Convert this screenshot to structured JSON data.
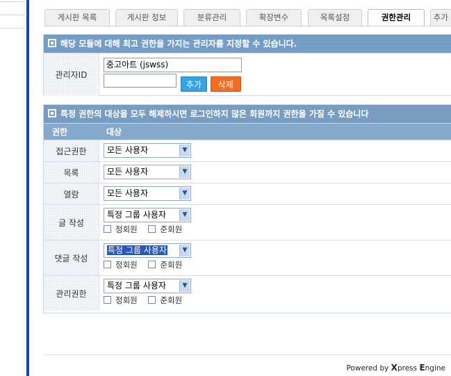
{
  "tabs": [
    {
      "label": "게시판 목록",
      "active": false
    },
    {
      "label": "게시판 정보",
      "active": false
    },
    {
      "label": "분류관리",
      "active": false
    },
    {
      "label": "확장변수",
      "active": false
    },
    {
      "label": "목록설정",
      "active": false
    },
    {
      "label": "권한관리",
      "active": true
    },
    {
      "label": "추가 설",
      "active": false
    }
  ],
  "admin_panel": {
    "header": "해당 모듈에 대해 최고 권한을 가지는 관리자를 지정할 수 있습니다.",
    "label": "관리자ID",
    "admin_list_value": "중고아트 (jswss)",
    "add_input_value": "",
    "add_button": "추가",
    "delete_button": "삭제"
  },
  "perm_panel": {
    "header": "특정 권한의 대상을 모두 해제하시면 로그인하지 않은 회원까지 권한을 가질 수 있습니다",
    "col_permission": "권한",
    "col_target": "대상",
    "rows": [
      {
        "label": "접근권한",
        "select": "모든 사용자",
        "groups": []
      },
      {
        "label": "목록",
        "select": "모든 사용자",
        "groups": []
      },
      {
        "label": "열람",
        "select": "모든 사용자",
        "groups": []
      },
      {
        "label": "글 작성",
        "select": "특정 그룹 사용자",
        "groups": [
          "정회원",
          "준회원"
        ]
      },
      {
        "label": "댓글 작성",
        "select": "특정 그룹 사용자",
        "groups": [
          "정회원",
          "준회원"
        ],
        "highlight": true
      },
      {
        "label": "관리권한",
        "select": "특정 그룹 사용자",
        "groups": [
          "정회원",
          "준회원"
        ]
      }
    ]
  },
  "footer": {
    "powered_by": "Powered by",
    "brand_x": "X",
    "brand_rest": "press",
    "brand_e": "E",
    "brand_engine_rest": "ngine"
  },
  "colors": {
    "panel_header": "#6f98c0",
    "column_header": "#7ea6cc",
    "add_button": "#37a1e3",
    "delete_button": "#f26d1f",
    "left_border": "#1f3fb4",
    "selection_highlight": "#2a56b8"
  },
  "icons": [
    "panel-header-icon",
    "dropdown-arrow-icon",
    "checkbox-icon"
  ]
}
